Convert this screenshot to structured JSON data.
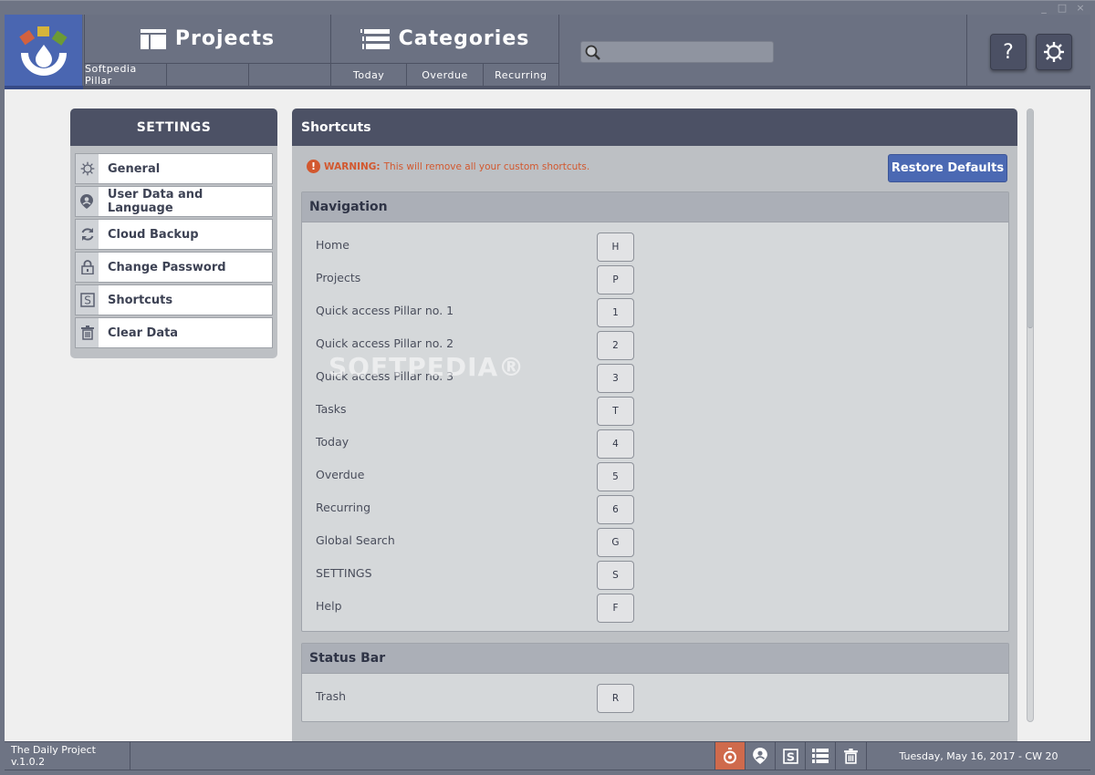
{
  "window": {
    "controls": {
      "minimize": "_",
      "maximize": "□",
      "close": "×"
    }
  },
  "header": {
    "logo": "app-logo",
    "projects": {
      "title": "Projects",
      "icon": "projects-icon",
      "sub": [
        "Softpedia Pillar",
        "",
        ""
      ]
    },
    "categories": {
      "title": "Categories",
      "icon": "categories-icon",
      "sub": [
        "Today",
        "Overdue",
        "Recurring"
      ]
    },
    "search": {
      "value": "",
      "placeholder": "",
      "icon": "search-icon"
    },
    "help_label": "?",
    "settings_icon": "gear-icon"
  },
  "settings": {
    "title": "SETTINGS",
    "items": [
      {
        "label": "General",
        "icon": "gear-icon"
      },
      {
        "label": "User Data and Language",
        "icon": "user-pin-icon"
      },
      {
        "label": "Cloud Backup",
        "icon": "sync-icon"
      },
      {
        "label": "Change Password",
        "icon": "lock-icon"
      },
      {
        "label": "Shortcuts",
        "icon": "shortcut-s-icon",
        "active": true
      },
      {
        "label": "Clear Data",
        "icon": "trash-icon"
      }
    ]
  },
  "main": {
    "title": "Shortcuts",
    "warning": {
      "prefix": "WARNING:",
      "text": "This will remove all your custom shortcuts.",
      "icon": "!",
      "color": "#d2582f"
    },
    "restore_label": "Restore Defaults",
    "sections": [
      {
        "title": "Navigation",
        "rows": [
          {
            "name": "Home",
            "key": "H"
          },
          {
            "name": "Projects",
            "key": "P"
          },
          {
            "name": "Quick access Pillar no. 1",
            "key": "1"
          },
          {
            "name": "Quick access Pillar no. 2",
            "key": "2"
          },
          {
            "name": "Quick access Pillar no. 3",
            "key": "3"
          },
          {
            "name": "Tasks",
            "key": "T"
          },
          {
            "name": "Today",
            "key": "4"
          },
          {
            "name": "Overdue",
            "key": "5"
          },
          {
            "name": "Recurring",
            "key": "6"
          },
          {
            "name": "Global Search",
            "key": "G"
          },
          {
            "name": "SETTINGS",
            "key": "S"
          },
          {
            "name": "Help",
            "key": "F"
          }
        ]
      },
      {
        "title": "Status Bar",
        "rows": [
          {
            "name": "Trash",
            "key": "R"
          }
        ]
      }
    ],
    "watermark": "SOFTPEDIA®"
  },
  "footer": {
    "version": "The Daily Project v.1.0.2",
    "icons": [
      "timer-icon",
      "user-pin-icon",
      "shortcut-s-icon",
      "categories-icon",
      "trash-icon"
    ],
    "date": "Tuesday, May 16, 2017 - CW 20"
  },
  "colors": {
    "accent": "#4b69b3",
    "header": "#6b7182",
    "panel_head": "#4c5165",
    "active_footer": "#cf6a4c"
  }
}
